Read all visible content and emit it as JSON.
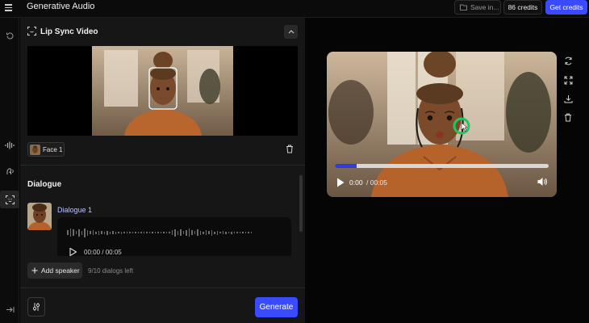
{
  "app": {
    "title": "Generative Audio"
  },
  "topbar": {
    "save_label": "Save in...",
    "credits_label": "86 credits",
    "get_credits_label": "Get credits"
  },
  "lipsync": {
    "title": "Lip Sync Video",
    "face_chip_label": "Face 1"
  },
  "dialogue": {
    "title": "Dialogue",
    "speaker_name": "Dialogue 1",
    "audio_time": "00:00",
    "audio_duration": "/ 00:05",
    "add_speaker_label": "Add speaker",
    "dialogs_left": "9/10 dialogs left"
  },
  "footer": {
    "generate_label": "Generate"
  },
  "player": {
    "current_time": "0:00",
    "duration": "/ 00:05",
    "progress_fraction": 0.1
  },
  "icons": {
    "rail": [
      "history-icon",
      "waveform-icon",
      "voice-icon",
      "face-scan-icon",
      "expand-icon"
    ],
    "side_tools": [
      "refresh-icon",
      "fullscreen-icon",
      "download-icon",
      "trash-icon"
    ]
  },
  "colors": {
    "accent": "#3a4bff",
    "panel": "#161616",
    "background": "#050505"
  }
}
